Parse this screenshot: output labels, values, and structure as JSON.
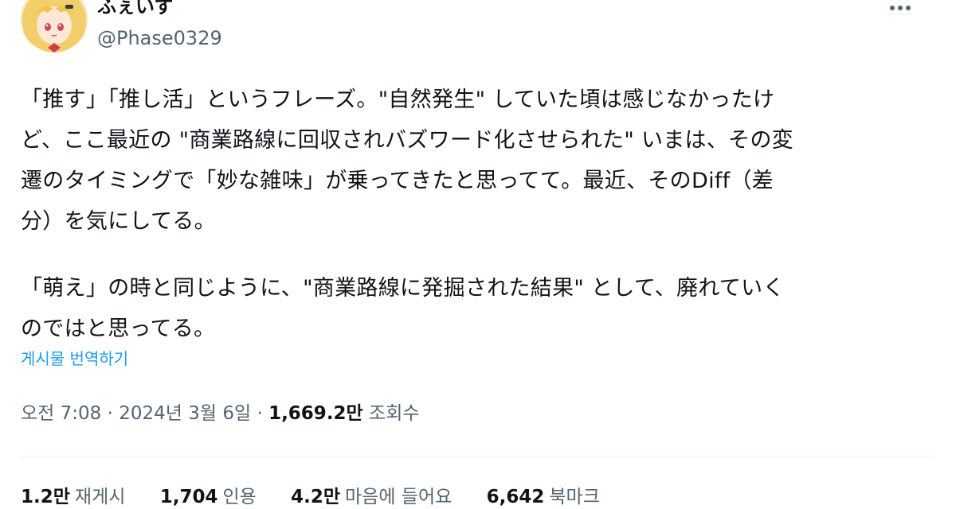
{
  "author": {
    "display_name": "ふぇいず",
    "handle": "@Phase0329"
  },
  "tweet": {
    "lines": [
      "「推す」「推し活」というフレーズ。\"自然発生\" していた頃は感じなかったけ",
      "ど、ここ最近の \"商業路線に回収されバズワード化させられた\" いまは、その変",
      "遷のタイミングで「妙な雑味」が乗ってきたと思ってて。最近、そのDiff（差",
      "分）を気にしてる。",
      "「萌え」の時と同じように、\"商業路線に発掘された結果\" として、廃れていく",
      "のではと思ってる。"
    ]
  },
  "translate_label": "게시물 번역하기",
  "meta": {
    "time": "오전 7:08",
    "separator": "·",
    "date": "2024년 3월 6일",
    "views_count": "1,669.2만",
    "views_label": "조회수"
  },
  "stats": [
    {
      "count": "1.2만",
      "label": "재게시"
    },
    {
      "count": "1,704",
      "label": "인용"
    },
    {
      "count": "4.2만",
      "label": "마음에 들어요"
    },
    {
      "count": "6,642",
      "label": "북마크"
    }
  ],
  "colors": {
    "accent": "#1d9bf0",
    "secondary_text": "#536471",
    "primary_text": "#0f1419"
  },
  "icons": {
    "more": "more-horizontal-icon",
    "avatar": "anime-girl-avatar"
  }
}
